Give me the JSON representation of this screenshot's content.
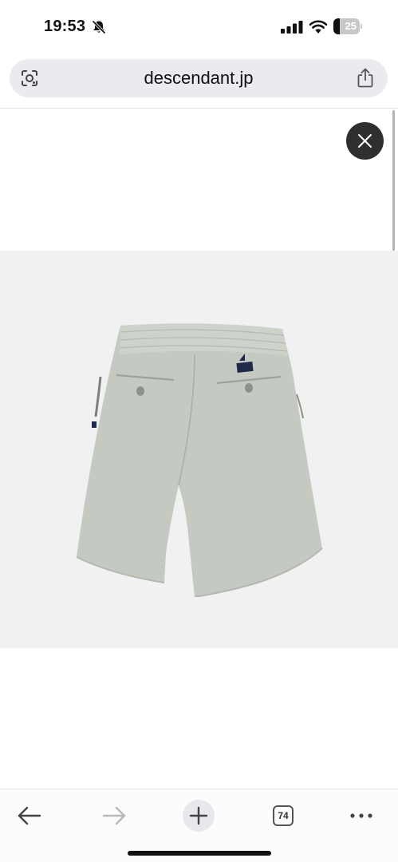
{
  "status_bar": {
    "time": "19:53",
    "battery_label": "25",
    "battery_level_percent": 25,
    "icons": [
      "bell-slash-icon",
      "cellular-signal-icon",
      "wifi-icon",
      "battery-icon"
    ]
  },
  "address_bar": {
    "url": "descendant.jp",
    "left_icon": "google-lens-icon",
    "right_icon": "share-icon"
  },
  "page": {
    "close_icon": "close-icon",
    "product_image": "grey-shorts-back-view",
    "colors": {
      "product_background": "#f1f1f1",
      "close_button": "#2f2f2f",
      "shorts": "#c4c9c2"
    }
  },
  "toolbar": {
    "tab_count": "74",
    "icons": [
      "back-arrow-icon",
      "forward-arrow-icon",
      "plus-icon",
      "tabs-icon",
      "more-icon"
    ]
  }
}
